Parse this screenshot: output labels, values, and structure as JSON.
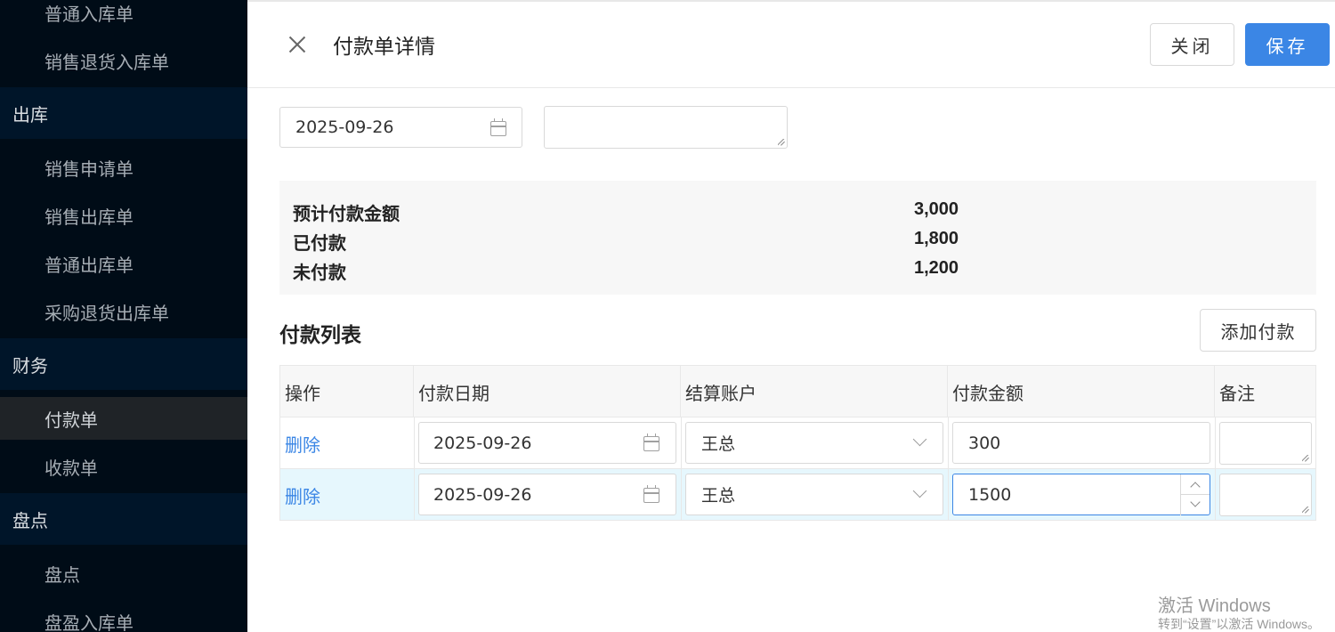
{
  "sidebar": {
    "items": [
      {
        "label": "普通入库单",
        "kind": "sub"
      },
      {
        "label": "销售退货入库单",
        "kind": "sub"
      },
      {
        "label": "出库",
        "kind": "group"
      },
      {
        "label": "销售申请单",
        "kind": "sub"
      },
      {
        "label": "销售出库单",
        "kind": "sub"
      },
      {
        "label": "普通出库单",
        "kind": "sub"
      },
      {
        "label": "采购退货出库单",
        "kind": "sub"
      },
      {
        "label": "财务",
        "kind": "group"
      },
      {
        "label": "付款单",
        "kind": "sub",
        "active": true
      },
      {
        "label": "收款单",
        "kind": "sub"
      },
      {
        "label": "盘点",
        "kind": "group"
      },
      {
        "label": "盘点",
        "kind": "sub"
      },
      {
        "label": "盘盈入库单",
        "kind": "sub"
      }
    ]
  },
  "header": {
    "title": "付款单详情",
    "close_label": "关闭",
    "save_label": "保存"
  },
  "form": {
    "date_value": "2025-09-26",
    "remark_value": ""
  },
  "summary": {
    "rows": [
      {
        "label": "预计付款金额",
        "value": "3,000"
      },
      {
        "label": "已付款",
        "value": "1,800"
      },
      {
        "label": "未付款",
        "value": "1,200"
      }
    ]
  },
  "payment_list": {
    "title": "付款列表",
    "add_label": "添加付款",
    "columns": [
      "操作",
      "付款日期",
      "结算账户",
      "付款金额",
      "备注"
    ],
    "rows": [
      {
        "action": "删除",
        "date": "2025-09-26",
        "account": "王总",
        "amount": "300",
        "remark": ""
      },
      {
        "action": "删除",
        "date": "2025-09-26",
        "account": "王总",
        "amount": "1500",
        "remark": ""
      }
    ]
  },
  "watermark": {
    "line1": "激活 Windows",
    "line2": "转到“设置”以激活 Windows。"
  },
  "colors": {
    "sidebar_bg": "#000c17",
    "accent": "#3b86e5",
    "link": "#3b86e5"
  }
}
